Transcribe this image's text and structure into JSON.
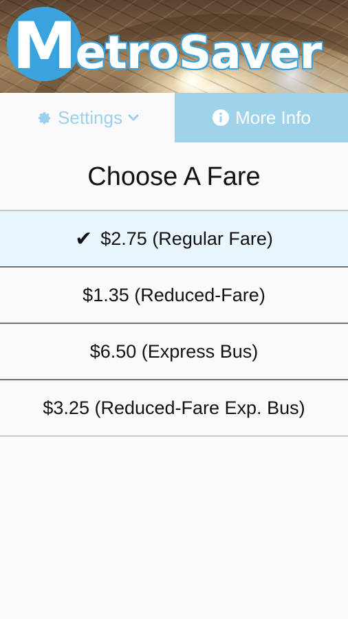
{
  "app": {
    "logo_first_letter": "M",
    "logo_rest": "etroSaver",
    "accent_color": "#3ba3dd",
    "tab_active_bg": "#9fd3ea"
  },
  "tabs": [
    {
      "label": "Settings",
      "icon": "gear-icon",
      "has_dropdown": true
    },
    {
      "label": "More Info",
      "icon": "info-icon"
    }
  ],
  "main": {
    "title": "Choose A Fare",
    "fares": [
      {
        "label": "$2.75 (Regular Fare)",
        "selected": true
      },
      {
        "label": "$1.35 (Reduced-Fare)",
        "selected": false
      },
      {
        "label": "$6.50 (Express Bus)",
        "selected": false
      },
      {
        "label": "$3.25 (Reduced-Fare Exp. Bus)",
        "selected": false
      }
    ],
    "selected_marker": "✔"
  }
}
